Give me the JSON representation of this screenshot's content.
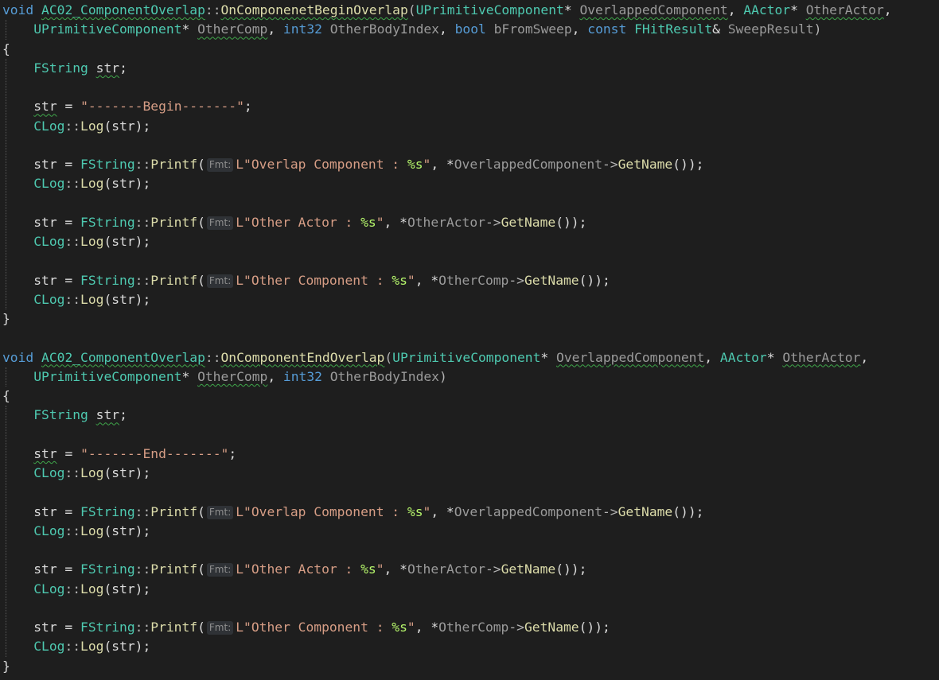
{
  "colors": {
    "background": "#1e1e1e",
    "keyword": "#569cd6",
    "type": "#4ec9b0",
    "function": "#dcdcaa",
    "parameter": "#9a9a9a",
    "string": "#d69d85",
    "format_specifier": "#b5f56b",
    "squiggle": "#3fa64a",
    "inlay_hint_bg": "#2f3236"
  },
  "lines": [
    [
      {
        "t": "void",
        "k": "kw"
      },
      {
        "t": " ",
        "k": "plain"
      },
      {
        "t": "AC02_ComponentOverlap",
        "k": "type",
        "sq": 1
      },
      {
        "t": "::",
        "k": "punc"
      },
      {
        "t": "OnComponenetBeginOverlap",
        "k": "fn",
        "sq": 1
      },
      {
        "t": "(",
        "k": "punc"
      },
      {
        "t": "UPrimitiveComponent",
        "k": "type"
      },
      {
        "t": "* ",
        "k": "plain"
      },
      {
        "t": "OverlappedComponent",
        "k": "param",
        "sq": 1
      },
      {
        "t": ", ",
        "k": "plain"
      },
      {
        "t": "AActor",
        "k": "type"
      },
      {
        "t": "* ",
        "k": "plain"
      },
      {
        "t": "OtherActor",
        "k": "param",
        "sq": 1
      },
      {
        "t": ",",
        "k": "plain"
      }
    ],
    [
      {
        "t": "    ",
        "k": "plain"
      },
      {
        "t": "UPrimitiveComponent",
        "k": "type"
      },
      {
        "t": "* ",
        "k": "plain"
      },
      {
        "t": "OtherComp",
        "k": "param",
        "sq": 1
      },
      {
        "t": ", ",
        "k": "plain"
      },
      {
        "t": "int32",
        "k": "kw"
      },
      {
        "t": " ",
        "k": "plain"
      },
      {
        "t": "OtherBodyIndex",
        "k": "param"
      },
      {
        "t": ", ",
        "k": "plain"
      },
      {
        "t": "bool",
        "k": "kw"
      },
      {
        "t": " ",
        "k": "plain"
      },
      {
        "t": "bFromSweep",
        "k": "param"
      },
      {
        "t": ", ",
        "k": "plain"
      },
      {
        "t": "const",
        "k": "kw"
      },
      {
        "t": " ",
        "k": "plain"
      },
      {
        "t": "FHitResult",
        "k": "type"
      },
      {
        "t": "& ",
        "k": "plain"
      },
      {
        "t": "SweepResult",
        "k": "param"
      },
      {
        "t": ")",
        "k": "punc"
      }
    ],
    [
      {
        "t": "{",
        "k": "plain"
      }
    ],
    [
      {
        "t": "    ",
        "k": "plain"
      },
      {
        "t": "FString",
        "k": "type"
      },
      {
        "t": " ",
        "k": "plain"
      },
      {
        "t": "str",
        "k": "var",
        "sq": 1
      },
      {
        "t": ";",
        "k": "plain"
      }
    ],
    [],
    [
      {
        "t": "    ",
        "k": "plain"
      },
      {
        "t": "str",
        "k": "var",
        "sq": 1
      },
      {
        "t": " = ",
        "k": "plain"
      },
      {
        "t": "\"-------Begin-------\"",
        "k": "str"
      },
      {
        "t": ";",
        "k": "plain"
      }
    ],
    [
      {
        "t": "    ",
        "k": "plain"
      },
      {
        "t": "CLog",
        "k": "type"
      },
      {
        "t": "::",
        "k": "punc"
      },
      {
        "t": "Log",
        "k": "fn"
      },
      {
        "t": "(str);",
        "k": "plain"
      }
    ],
    [],
    [
      {
        "t": "    str = ",
        "k": "plain"
      },
      {
        "t": "FString",
        "k": "type"
      },
      {
        "t": "::",
        "k": "punc"
      },
      {
        "t": "Printf",
        "k": "fn"
      },
      {
        "t": "(",
        "k": "plain"
      },
      {
        "h": "Fmt:"
      },
      {
        "t": "L\"Overlap Component : ",
        "k": "str"
      },
      {
        "t": "%s",
        "k": "fmt"
      },
      {
        "t": "\"",
        "k": "str"
      },
      {
        "t": ", *",
        "k": "plain"
      },
      {
        "t": "OverlappedComponent",
        "k": "param"
      },
      {
        "t": "->",
        "k": "punc"
      },
      {
        "t": "GetName",
        "k": "fn"
      },
      {
        "t": "());",
        "k": "plain"
      }
    ],
    [
      {
        "t": "    ",
        "k": "plain"
      },
      {
        "t": "CLog",
        "k": "type"
      },
      {
        "t": "::",
        "k": "punc"
      },
      {
        "t": "Log",
        "k": "fn"
      },
      {
        "t": "(str);",
        "k": "plain"
      }
    ],
    [],
    [
      {
        "t": "    str = ",
        "k": "plain"
      },
      {
        "t": "FString",
        "k": "type"
      },
      {
        "t": "::",
        "k": "punc"
      },
      {
        "t": "Printf",
        "k": "fn"
      },
      {
        "t": "(",
        "k": "plain"
      },
      {
        "h": "Fmt:"
      },
      {
        "t": "L\"Other Actor : ",
        "k": "str"
      },
      {
        "t": "%s",
        "k": "fmt"
      },
      {
        "t": "\"",
        "k": "str"
      },
      {
        "t": ", *",
        "k": "plain"
      },
      {
        "t": "OtherActor",
        "k": "param"
      },
      {
        "t": "->",
        "k": "punc"
      },
      {
        "t": "GetName",
        "k": "fn"
      },
      {
        "t": "());",
        "k": "plain"
      }
    ],
    [
      {
        "t": "    ",
        "k": "plain"
      },
      {
        "t": "CLog",
        "k": "type"
      },
      {
        "t": "::",
        "k": "punc"
      },
      {
        "t": "Log",
        "k": "fn"
      },
      {
        "t": "(str);",
        "k": "plain"
      }
    ],
    [],
    [
      {
        "t": "    str = ",
        "k": "plain"
      },
      {
        "t": "FString",
        "k": "type"
      },
      {
        "t": "::",
        "k": "punc"
      },
      {
        "t": "Printf",
        "k": "fn"
      },
      {
        "t": "(",
        "k": "plain"
      },
      {
        "h": "Fmt:"
      },
      {
        "t": "L\"Other Component : ",
        "k": "str"
      },
      {
        "t": "%s",
        "k": "fmt"
      },
      {
        "t": "\"",
        "k": "str"
      },
      {
        "t": ", *",
        "k": "plain"
      },
      {
        "t": "OtherComp",
        "k": "param"
      },
      {
        "t": "->",
        "k": "punc"
      },
      {
        "t": "GetName",
        "k": "fn"
      },
      {
        "t": "());",
        "k": "plain"
      }
    ],
    [
      {
        "t": "    ",
        "k": "plain"
      },
      {
        "t": "CLog",
        "k": "type"
      },
      {
        "t": "::",
        "k": "punc"
      },
      {
        "t": "Log",
        "k": "fn"
      },
      {
        "t": "(str);",
        "k": "plain"
      }
    ],
    [
      {
        "t": "}",
        "k": "plain"
      }
    ],
    [],
    [
      {
        "t": "void",
        "k": "kw"
      },
      {
        "t": " ",
        "k": "plain"
      },
      {
        "t": "AC02_ComponentOverlap",
        "k": "type",
        "sq": 1
      },
      {
        "t": "::",
        "k": "punc"
      },
      {
        "t": "OnComponentEndOverlap",
        "k": "fn",
        "sq": 1
      },
      {
        "t": "(",
        "k": "punc"
      },
      {
        "t": "UPrimitiveComponent",
        "k": "type"
      },
      {
        "t": "* ",
        "k": "plain"
      },
      {
        "t": "OverlappedComponent",
        "k": "param",
        "sq": 1
      },
      {
        "t": ", ",
        "k": "plain"
      },
      {
        "t": "AActor",
        "k": "type"
      },
      {
        "t": "* ",
        "k": "plain"
      },
      {
        "t": "OtherActor",
        "k": "param",
        "sq": 1
      },
      {
        "t": ",",
        "k": "plain"
      }
    ],
    [
      {
        "t": "    ",
        "k": "plain"
      },
      {
        "t": "UPrimitiveComponent",
        "k": "type"
      },
      {
        "t": "* ",
        "k": "plain"
      },
      {
        "t": "OtherComp",
        "k": "param",
        "sq": 1
      },
      {
        "t": ", ",
        "k": "plain"
      },
      {
        "t": "int32",
        "k": "kw"
      },
      {
        "t": " ",
        "k": "plain"
      },
      {
        "t": "OtherBodyIndex",
        "k": "param"
      },
      {
        "t": ")",
        "k": "punc"
      }
    ],
    [
      {
        "t": "{",
        "k": "plain"
      }
    ],
    [
      {
        "t": "    ",
        "k": "plain"
      },
      {
        "t": "FString",
        "k": "type"
      },
      {
        "t": " ",
        "k": "plain"
      },
      {
        "t": "str",
        "k": "var",
        "sq": 1
      },
      {
        "t": ";",
        "k": "plain"
      }
    ],
    [],
    [
      {
        "t": "    ",
        "k": "plain"
      },
      {
        "t": "str",
        "k": "var",
        "sq": 1
      },
      {
        "t": " = ",
        "k": "plain"
      },
      {
        "t": "\"-------End-------\"",
        "k": "str"
      },
      {
        "t": ";",
        "k": "plain"
      }
    ],
    [
      {
        "t": "    ",
        "k": "plain"
      },
      {
        "t": "CLog",
        "k": "type"
      },
      {
        "t": "::",
        "k": "punc"
      },
      {
        "t": "Log",
        "k": "fn"
      },
      {
        "t": "(str);",
        "k": "plain"
      }
    ],
    [],
    [
      {
        "t": "    str = ",
        "k": "plain"
      },
      {
        "t": "FString",
        "k": "type"
      },
      {
        "t": "::",
        "k": "punc"
      },
      {
        "t": "Printf",
        "k": "fn"
      },
      {
        "t": "(",
        "k": "plain"
      },
      {
        "h": "Fmt:"
      },
      {
        "t": "L\"Overlap Component : ",
        "k": "str"
      },
      {
        "t": "%s",
        "k": "fmt"
      },
      {
        "t": "\"",
        "k": "str"
      },
      {
        "t": ", *",
        "k": "plain"
      },
      {
        "t": "OverlappedComponent",
        "k": "param"
      },
      {
        "t": "->",
        "k": "punc"
      },
      {
        "t": "GetName",
        "k": "fn"
      },
      {
        "t": "());",
        "k": "plain"
      }
    ],
    [
      {
        "t": "    ",
        "k": "plain"
      },
      {
        "t": "CLog",
        "k": "type"
      },
      {
        "t": "::",
        "k": "punc"
      },
      {
        "t": "Log",
        "k": "fn"
      },
      {
        "t": "(str);",
        "k": "plain"
      }
    ],
    [],
    [
      {
        "t": "    str = ",
        "k": "plain"
      },
      {
        "t": "FString",
        "k": "type"
      },
      {
        "t": "::",
        "k": "punc"
      },
      {
        "t": "Printf",
        "k": "fn"
      },
      {
        "t": "(",
        "k": "plain"
      },
      {
        "h": "Fmt:"
      },
      {
        "t": "L\"Other Actor : ",
        "k": "str"
      },
      {
        "t": "%s",
        "k": "fmt"
      },
      {
        "t": "\"",
        "k": "str"
      },
      {
        "t": ", *",
        "k": "plain"
      },
      {
        "t": "OtherActor",
        "k": "param"
      },
      {
        "t": "->",
        "k": "punc"
      },
      {
        "t": "GetName",
        "k": "fn"
      },
      {
        "t": "());",
        "k": "plain"
      }
    ],
    [
      {
        "t": "    ",
        "k": "plain"
      },
      {
        "t": "CLog",
        "k": "type"
      },
      {
        "t": "::",
        "k": "punc"
      },
      {
        "t": "Log",
        "k": "fn"
      },
      {
        "t": "(str);",
        "k": "plain"
      }
    ],
    [],
    [
      {
        "t": "    str = ",
        "k": "plain"
      },
      {
        "t": "FString",
        "k": "type"
      },
      {
        "t": "::",
        "k": "punc"
      },
      {
        "t": "Printf",
        "k": "fn"
      },
      {
        "t": "(",
        "k": "plain"
      },
      {
        "h": "Fmt:"
      },
      {
        "t": "L\"Other Component : ",
        "k": "str"
      },
      {
        "t": "%s",
        "k": "fmt"
      },
      {
        "t": "\"",
        "k": "str"
      },
      {
        "t": ", *",
        "k": "plain"
      },
      {
        "t": "OtherComp",
        "k": "param"
      },
      {
        "t": "->",
        "k": "punc"
      },
      {
        "t": "GetName",
        "k": "fn"
      },
      {
        "t": "());",
        "k": "plain"
      }
    ],
    [
      {
        "t": "    ",
        "k": "plain"
      },
      {
        "t": "CLog",
        "k": "type"
      },
      {
        "t": "::",
        "k": "punc"
      },
      {
        "t": "Log",
        "k": "fn"
      },
      {
        "t": "(str);",
        "k": "plain"
      }
    ],
    [
      {
        "t": "}",
        "k": "plain"
      }
    ]
  ]
}
